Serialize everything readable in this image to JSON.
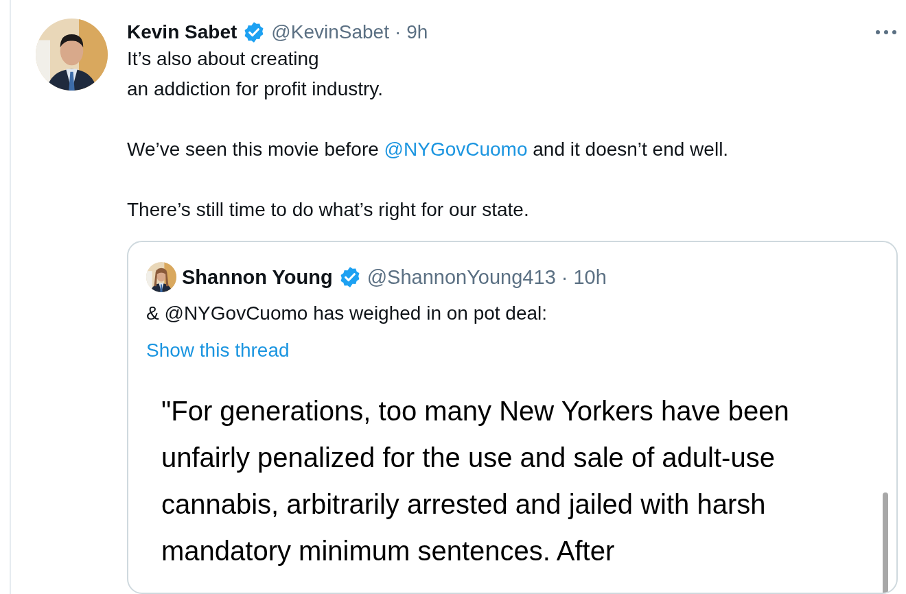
{
  "tweet": {
    "name": "Kevin Sabet",
    "verified": true,
    "handle": "@KevinSabet",
    "separator": "·",
    "time": "9h",
    "paragraphs": [
      [
        {
          "kind": "text",
          "text": "It’s also about creating\nan addiction for profit industry."
        }
      ],
      [
        {
          "kind": "text",
          "text": "We’ve seen this movie before "
        },
        {
          "kind": "mention",
          "text": "@NYGovCuomo"
        },
        {
          "kind": "text",
          "text": " and it doesn’t end well."
        }
      ],
      [
        {
          "kind": "text",
          "text": "There’s still time to do what’s right for our state."
        }
      ]
    ],
    "quote": {
      "name": "Shannon Young",
      "verified": true,
      "handle": "@ShannonYoung413",
      "separator": "·",
      "time": "10h",
      "text": "& @NYGovCuomo has weighed in on pot deal:",
      "link": "Show this thread",
      "media_text": "\"For generations, too many New Yorkers have been unfairly penalized for the use and sale of adult-use cannabis, arbitrarily arrested and jailed with harsh mandatory minimum sentences. After"
    }
  }
}
